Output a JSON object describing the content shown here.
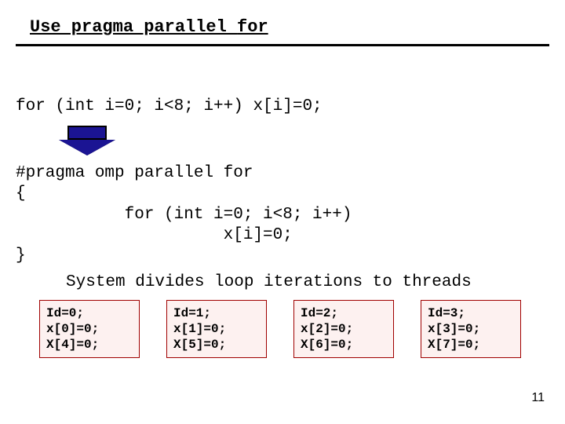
{
  "title": {
    "prefix": "Use pragma parallel ",
    "keyword": "for"
  },
  "code_before": "for (int i=0; i<8; i++) x[i]=0;",
  "code_after": "#pragma omp parallel for\n{\n           for (int i=0; i<8; i++)\n                     x[i]=0;\n}",
  "caption": "System divides loop iterations to threads",
  "threads": [
    {
      "id_line": "Id=0;",
      "l1": "x[0]=0;",
      "l2": "X[4]=0;"
    },
    {
      "id_line": "Id=1;",
      "l1": "x[1]=0;",
      "l2": "X[5]=0;"
    },
    {
      "id_line": "Id=2;",
      "l1": "x[2]=0;",
      "l2": "X[6]=0;"
    },
    {
      "id_line": "Id=3;",
      "l1": "x[3]=0;",
      "l2": "X[7]=0;"
    }
  ],
  "page_number": "11"
}
